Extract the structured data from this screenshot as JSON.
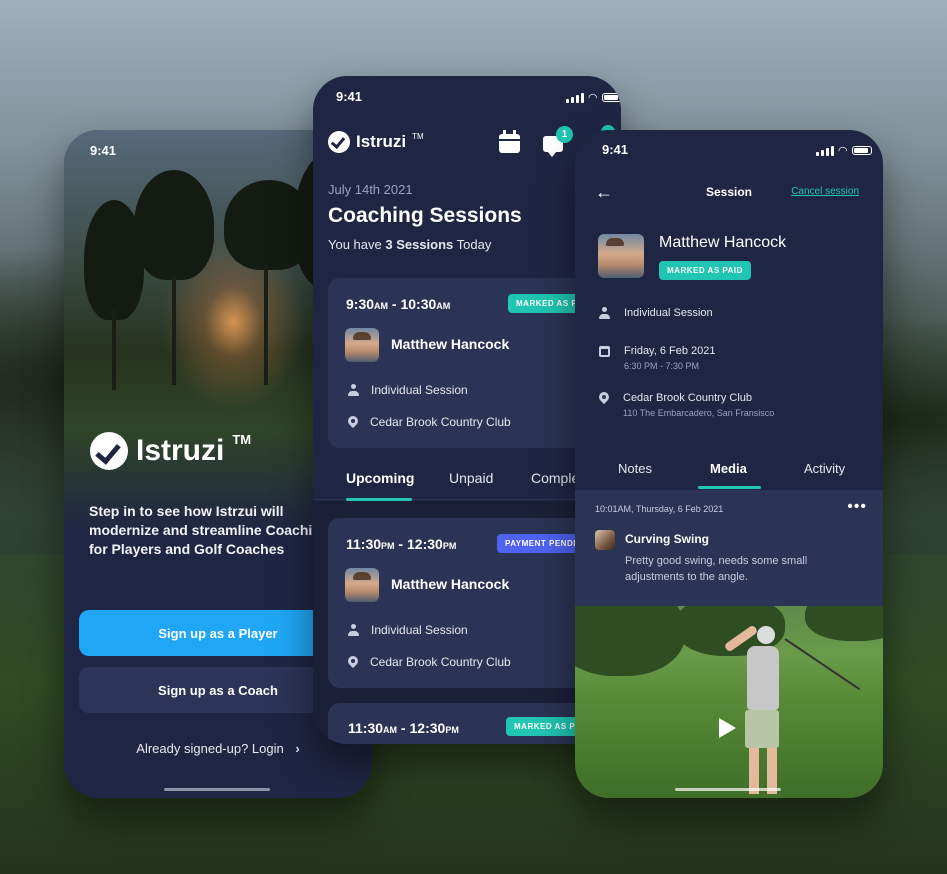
{
  "phone1": {
    "time": "9:41",
    "brand": "Istruzi",
    "brand_tm": "TM",
    "intro": "Step in to see how Istrzui will modernize and streamline Coaching for Players and Golf Coaches",
    "btn_player": "Sign up as a Player",
    "btn_coach": "Sign up as a Coach",
    "login": "Already signed-up? Login",
    "login_arrow": "›"
  },
  "phone2": {
    "time": "9:41",
    "brand": "Istruzi",
    "brand_tm": "TM",
    "notification_count": "1",
    "date": "July 14th 2021",
    "title": "Coaching Sessions",
    "subtitle_pre": "You have ",
    "subtitle_bold": "3 Sessions",
    "subtitle_post": " Today",
    "sessions": [
      {
        "start": "9:30",
        "start_ampm": "AM",
        "sep": " - ",
        "end": "10:30",
        "end_ampm": "AM",
        "badge": "MARKED AS PAID",
        "name": "Matthew Hancock",
        "type": "Individual Session",
        "location": "Cedar Brook Country Club"
      },
      {
        "start": "11:30",
        "start_ampm": "PM",
        "sep": " - ",
        "end": "12:30",
        "end_ampm": "PM",
        "badge": "PAYMENT PENDING",
        "name": "Matthew Hancock",
        "type": "Individual Session",
        "location": "Cedar Brook Country Club"
      },
      {
        "start": "11:30",
        "start_ampm": "AM",
        "sep": " - ",
        "end": "12:30",
        "end_ampm": "PM",
        "badge": "MARKED AS PAID"
      }
    ],
    "tabs": [
      "Upcoming",
      "Unpaid",
      "Completed"
    ]
  },
  "phone3": {
    "time": "9:41",
    "nav_title": "Session",
    "cancel": "Cancel session",
    "player_name": "Matthew Hancock",
    "badge": "MARKED AS PAID",
    "session_type": "Individual Session",
    "date": "Friday, 6 Feb 2021",
    "time_range": "6:30 PM - 7:30 PM",
    "club": "Cedar Brook Country Club",
    "address": "110 The Embarcadero, San Fransisco",
    "tabs": [
      "Notes",
      "Media",
      "Activity"
    ],
    "note": {
      "timestamp": "10:01AM, Thursday, 6 Feb 2021",
      "title": "Curving Swing",
      "body": "Pretty good swing, needs some small adjustments to the angle."
    }
  },
  "colors": {
    "accent": "#20c6b2",
    "primary_button": "#1fa7f5",
    "pending": "#4f62f2",
    "surface": "#1f2644",
    "card": "#2b3454"
  }
}
